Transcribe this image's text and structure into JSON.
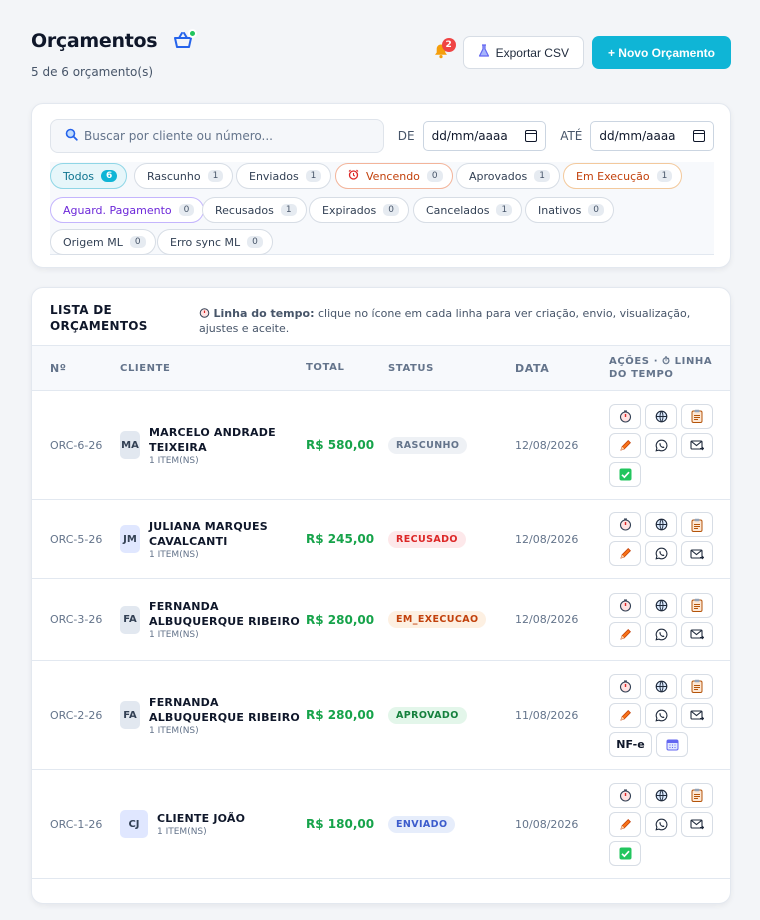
{
  "header": {
    "title": "Orçamentos",
    "subtitle": "5 de 6 orçamento(s)",
    "notification_count": "2",
    "export_label": "Exportar CSV",
    "new_label": "+ Novo Orçamento",
    "accent_color": "#0fb5d6"
  },
  "filters": {
    "search_placeholder": "Buscar por cliente ou número...",
    "from_label": "DE",
    "to_label": "ATÉ",
    "date_placeholder": "dd/mm/aaaa",
    "chips": [
      {
        "label": "Todos",
        "count": "6"
      },
      {
        "label": "Rascunho",
        "count": "1"
      },
      {
        "label": "Enviados",
        "count": "1"
      },
      {
        "label": "Vencendo",
        "count": "0"
      },
      {
        "label": "Aprovados",
        "count": "1"
      },
      {
        "label": "Em Execução",
        "count": "1"
      },
      {
        "label": "Aguard. Pagamento",
        "count": "0"
      },
      {
        "label": "Recusados",
        "count": "1"
      },
      {
        "label": "Expirados",
        "count": "0"
      },
      {
        "label": "Cancelados",
        "count": "1"
      },
      {
        "label": "Inativos",
        "count": "0"
      },
      {
        "label": "Origem ML",
        "count": "0"
      },
      {
        "label": "Erro sync ML",
        "count": "0"
      }
    ]
  },
  "list": {
    "title": "LISTA DE ORÇAMENTOS",
    "note_bold": "Linha do tempo:",
    "note_text": " clique no ícone em cada linha para ver criação, envio, visualização, ajustes e aceite.",
    "columns": {
      "num": "Nº",
      "client": "CLIENTE",
      "total": "TOTAL",
      "status": "STATUS",
      "date": "DATA",
      "actions": "AÇÕES · ⏱ LINHA DO TEMPO"
    },
    "rows": [
      {
        "num": "ORC-6-26",
        "initials": "MA",
        "client": "MARCELO ANDRADE TEIXEIRA",
        "items": "1 ITEM(NS)",
        "total": "R$ 580,00",
        "status": "RASCUNHO",
        "date": "12/08/2026"
      },
      {
        "num": "ORC-5-26",
        "initials": "JM",
        "client": "JULIANA MARQUES CAVALCANTI",
        "items": "1 ITEM(NS)",
        "total": "R$ 245,00",
        "status": "RECUSADO",
        "date": "12/08/2026"
      },
      {
        "num": "ORC-3-26",
        "initials": "FA",
        "client": "FERNANDA ALBUQUERQUE RIBEIRO",
        "items": "1 ITEM(NS)",
        "total": "R$ 280,00",
        "status": "EM_EXECUCAO",
        "date": "12/08/2026"
      },
      {
        "num": "ORC-2-26",
        "initials": "FA",
        "client": "FERNANDA ALBUQUERQUE RIBEIRO",
        "items": "1 ITEM(NS)",
        "total": "R$ 280,00",
        "status": "APROVADO",
        "date": "11/08/2026",
        "nfe_label": "NF-e"
      },
      {
        "num": "ORC-1-26",
        "initials": "CJ",
        "client": "CLIENTE JOÃO",
        "items": "1 ITEM(NS)",
        "total": "R$ 180,00",
        "status": "ENVIADO",
        "date": "10/08/2026"
      }
    ]
  }
}
